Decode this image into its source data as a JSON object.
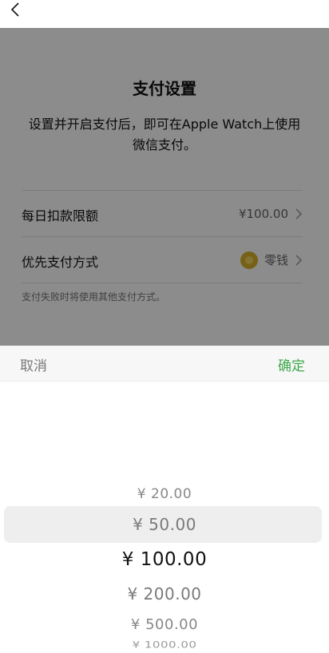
{
  "settings": {
    "title": "支付设置",
    "description": "设置并开启支付后，即可在Apple Watch上使用微信支付。",
    "rows": [
      {
        "label": "每日扣款限额",
        "value": "¥100.00"
      },
      {
        "label": "优先支付方式",
        "value": "零钱",
        "icon": "coin-icon"
      }
    ],
    "note": "支付失败时将使用其他支付方式。"
  },
  "picker": {
    "cancel_label": "取消",
    "confirm_label": "确定",
    "options": [
      "¥ 20.00",
      "¥ 50.00",
      "¥ 100.00",
      "¥ 200.00",
      "¥ 500.00",
      "¥ 1000.00"
    ],
    "selected": "¥ 100.00"
  },
  "colors": {
    "confirm": "#3fa84b",
    "overlay": "rgba(0,0,0,0.45)"
  }
}
